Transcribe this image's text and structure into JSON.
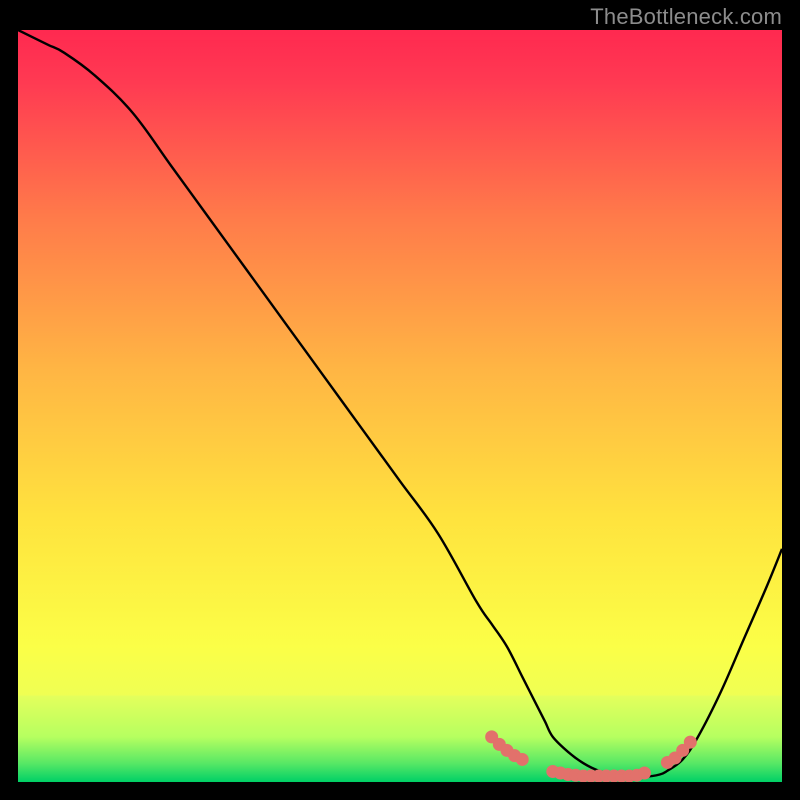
{
  "watermark": "TheBottleneck.com",
  "chart_data": {
    "type": "line",
    "title": "",
    "xlabel": "",
    "ylabel": "",
    "xlim": [
      0,
      100
    ],
    "ylim": [
      0,
      100
    ],
    "grid": false,
    "legend": false,
    "background_gradient": {
      "top": "#ff2950",
      "mid": "#ffe73a",
      "green_band_top": "#e9ff5c",
      "green_band_bottom": "#00d66a"
    },
    "series": [
      {
        "name": "bottleneck-curve",
        "x": [
          0,
          2,
          4,
          6,
          10,
          15,
          20,
          25,
          30,
          35,
          40,
          45,
          50,
          55,
          60,
          62,
          64,
          66,
          67,
          68,
          69,
          70,
          72,
          74,
          76,
          78,
          80,
          82,
          84,
          85,
          87,
          89,
          92,
          95,
          98,
          100
        ],
        "y": [
          100,
          99,
          98,
          97,
          94,
          89,
          82,
          75,
          68,
          61,
          54,
          47,
          40,
          33,
          24,
          21,
          18,
          14,
          12,
          10,
          8,
          6,
          4,
          2.5,
          1.5,
          1,
          0.8,
          0.7,
          1,
          1.5,
          3,
          6,
          12,
          19,
          26,
          31
        ]
      }
    ],
    "markers": {
      "name": "highlight-dots",
      "color": "#e2716b",
      "points": [
        {
          "x": 62,
          "y": 6
        },
        {
          "x": 63,
          "y": 5
        },
        {
          "x": 64,
          "y": 4.2
        },
        {
          "x": 65,
          "y": 3.5
        },
        {
          "x": 66,
          "y": 3
        },
        {
          "x": 70,
          "y": 1.4
        },
        {
          "x": 71,
          "y": 1.2
        },
        {
          "x": 72,
          "y": 1
        },
        {
          "x": 73,
          "y": 0.9
        },
        {
          "x": 74,
          "y": 0.8
        },
        {
          "x": 75,
          "y": 0.8
        },
        {
          "x": 76,
          "y": 0.8
        },
        {
          "x": 77,
          "y": 0.8
        },
        {
          "x": 78,
          "y": 0.8
        },
        {
          "x": 79,
          "y": 0.8
        },
        {
          "x": 80,
          "y": 0.8
        },
        {
          "x": 81,
          "y": 0.9
        },
        {
          "x": 82,
          "y": 1.2
        },
        {
          "x": 85,
          "y": 2.6
        },
        {
          "x": 86,
          "y": 3.2
        },
        {
          "x": 87,
          "y": 4.2
        },
        {
          "x": 88,
          "y": 5.3
        }
      ]
    }
  }
}
